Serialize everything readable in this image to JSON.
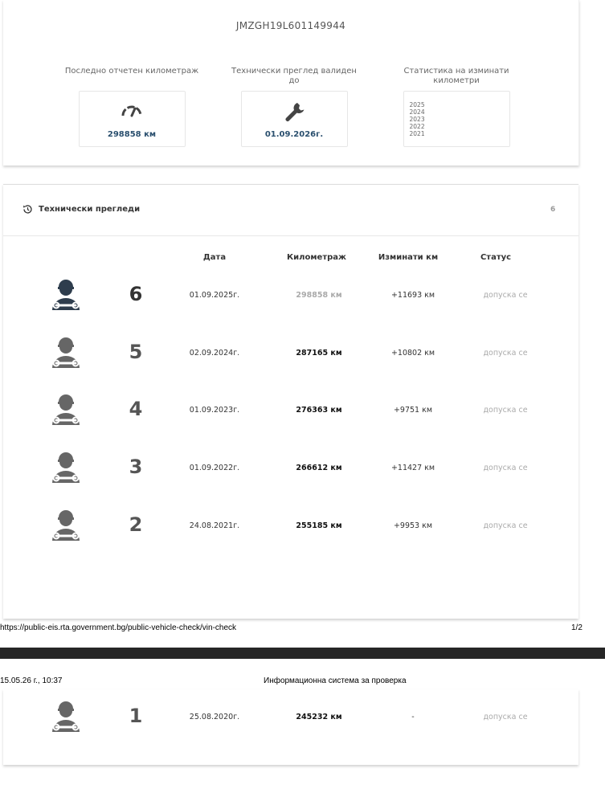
{
  "vin": "JMZGH19L601149944",
  "stats": [
    {
      "label": "Последно отчетен километраж",
      "value": "298858 км",
      "icon": "speedometer-icon"
    },
    {
      "label": "Технически преглед валиден до",
      "value": "01.09.2026г.",
      "icon": "wrench-icon"
    },
    {
      "label": "Статистика на изминати километри",
      "years": [
        "2025",
        "2024",
        "2023",
        "2022",
        "2021"
      ]
    }
  ],
  "inspections": {
    "title": "Технически прегледи",
    "count": "6",
    "columns": {
      "date": "Дата",
      "km": "Километраж",
      "diff": "Изминати км",
      "status": "Статус"
    },
    "rows": [
      {
        "num": "6",
        "date": "01.09.2025г.",
        "km": "298858 км",
        "diff": "+11693 км",
        "status": "допуска се"
      },
      {
        "num": "5",
        "date": "02.09.2024г.",
        "km": "287165 км",
        "diff": "+10802 км",
        "status": "допуска се"
      },
      {
        "num": "4",
        "date": "01.09.2023г.",
        "km": "276363 км",
        "diff": "+9751 км",
        "status": "допуска се"
      },
      {
        "num": "3",
        "date": "01.09.2022г.",
        "km": "266612 км",
        "diff": "+11427 км",
        "status": "допуска се"
      },
      {
        "num": "2",
        "date": "24.08.2021г.",
        "km": "255185 км",
        "diff": "+9953 км",
        "status": "допуска се"
      },
      {
        "num": "1",
        "date": "25.08.2020г.",
        "km": "245232 км",
        "diff": "-",
        "status": "допуска се"
      }
    ]
  },
  "print": {
    "url": "https://public-eis.rta.government.bg/public-vehicle-check/vin-check",
    "page": "1/2",
    "datetime": "15.05.26 г., 10:37",
    "title": "Информационна система за проверка"
  },
  "colors": {
    "accent": "#2a4f6e",
    "muted": "#aaaaaa",
    "icon": "#555555"
  }
}
